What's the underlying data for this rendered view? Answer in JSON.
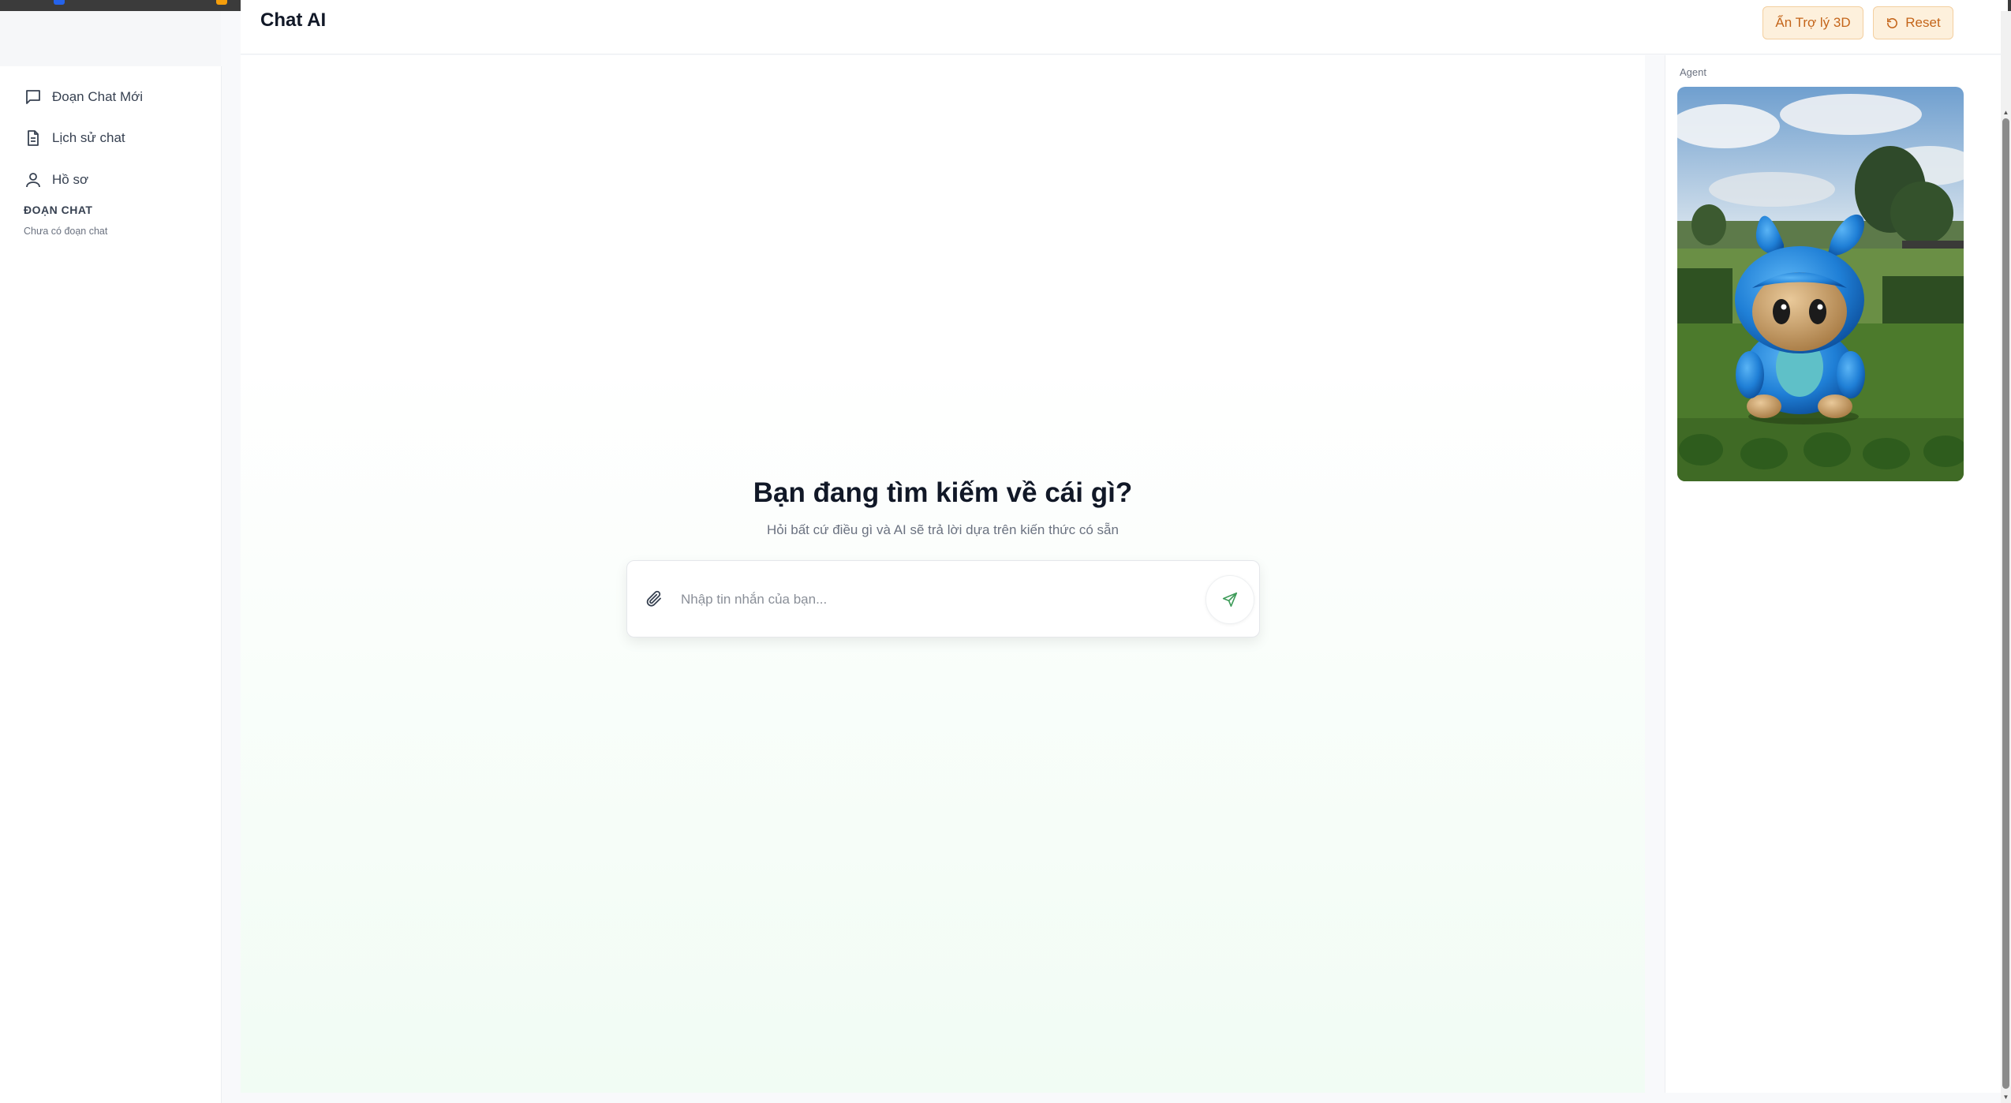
{
  "app": {
    "title": "Chat AI"
  },
  "header": {
    "toggle_3d_label": "Ẩn Trợ lý 3D",
    "reset_label": "Reset"
  },
  "sidebar": {
    "items": [
      {
        "label": "Đoạn Chat Mới",
        "icon": "chat-bubble-icon"
      },
      {
        "label": "Lịch sử chat",
        "icon": "document-icon"
      },
      {
        "label": "Hồ sơ",
        "icon": "user-icon"
      }
    ],
    "section_title": "ĐOẠN CHAT",
    "empty_text": "Chưa có đoạn chat"
  },
  "main": {
    "heading": "Bạn đang tìm kiếm về cái gì?",
    "subheading": "Hỏi bất cứ điều gì và AI sẽ trả lời dựa trên kiến thức có sẵn",
    "input": {
      "value": "",
      "placeholder": "Nhập tin nhắn của bạn..."
    },
    "attach_icon": "paperclip-icon",
    "send_icon": "send-icon"
  },
  "agent_panel": {
    "label": "Agent",
    "image": "3d-blue-mascot-in-garden"
  },
  "colors": {
    "accent_orange": "#c4651a",
    "button_bg": "#fdf0dc",
    "send_green": "#3f9c5a"
  }
}
